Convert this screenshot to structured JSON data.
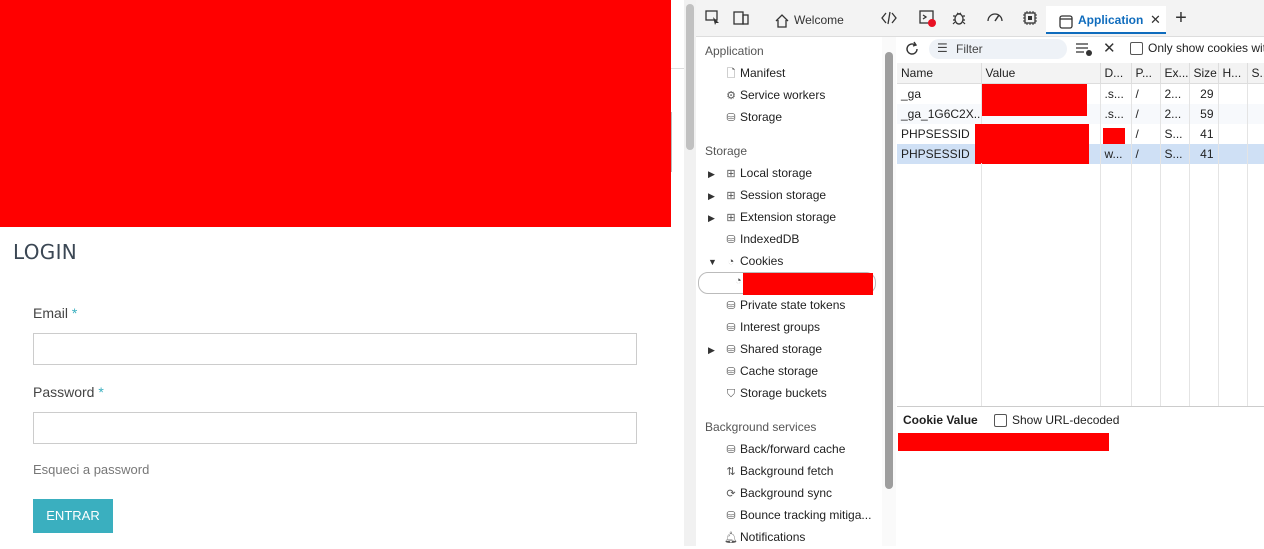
{
  "page": {
    "login_title": "LOGIN",
    "email_label": "Email",
    "password_label": "Password",
    "required_mark": "*",
    "forgot_link": "Esqueci a password",
    "submit_label": "ENTRAR"
  },
  "devtools": {
    "tabs": [
      {
        "label": "Welcome",
        "icon": "home-icon"
      },
      {
        "label": "Application",
        "icon": "window-icon"
      }
    ],
    "add_tab": "+",
    "close_tab": "✕",
    "filter_placeholder": "Filter",
    "only_show_label": "Only show cookies wit",
    "sidebar": {
      "sections": [
        {
          "title": "Application",
          "items": [
            {
              "label": "Manifest",
              "icon": "file-icon"
            },
            {
              "label": "Service workers",
              "icon": "gear-icon"
            },
            {
              "label": "Storage",
              "icon": "database-icon"
            }
          ]
        },
        {
          "title": "Storage",
          "items": [
            {
              "label": "Local storage",
              "icon": "grid-icon",
              "expandable": true
            },
            {
              "label": "Session storage",
              "icon": "grid-icon",
              "expandable": true
            },
            {
              "label": "Extension storage",
              "icon": "grid-icon",
              "expandable": true
            },
            {
              "label": "IndexedDB",
              "icon": "database-icon"
            },
            {
              "label": "Cookies",
              "icon": "cookie-icon",
              "expanded": true
            },
            {
              "label": "",
              "icon": "cookie-icon",
              "child": true,
              "redacted": true
            },
            {
              "label": "Private state tokens",
              "icon": "database-icon"
            },
            {
              "label": "Interest groups",
              "icon": "database-icon"
            },
            {
              "label": "Shared storage",
              "icon": "database-icon",
              "expandable": true
            },
            {
              "label": "Cache storage",
              "icon": "database-icon"
            },
            {
              "label": "Storage buckets",
              "icon": "bucket-icon"
            }
          ]
        },
        {
          "title": "Background services",
          "items": [
            {
              "label": "Back/forward cache",
              "icon": "database-icon"
            },
            {
              "label": "Background fetch",
              "icon": "arrows-updown-icon"
            },
            {
              "label": "Background sync",
              "icon": "sync-icon"
            },
            {
              "label": "Bounce tracking mitiga...",
              "icon": "database-icon"
            },
            {
              "label": "Notifications",
              "icon": "bell-icon"
            }
          ]
        }
      ]
    },
    "table": {
      "columns": [
        "Name",
        "Value",
        "D...",
        "P...",
        "Ex...",
        "Size",
        "H...",
        "S..."
      ],
      "rows": [
        {
          "name": "_ga",
          "value": "",
          "domain": ".s...",
          "path": "/",
          "expires": "2...",
          "size": "29",
          "httponly": "",
          "secure": ""
        },
        {
          "name": "_ga_1G6C2X...",
          "value": "",
          "domain": ".s...",
          "path": "/",
          "expires": "2...",
          "size": "59",
          "httponly": "",
          "secure": ""
        },
        {
          "name": "PHPSESSID",
          "value": "",
          "domain": "",
          "path": "/",
          "expires": "S...",
          "size": "41",
          "httponly": "",
          "secure": ""
        },
        {
          "name": "PHPSESSID",
          "value": "",
          "domain": "w...",
          "path": "/",
          "expires": "S...",
          "size": "41",
          "httponly": "",
          "secure": ""
        }
      ]
    },
    "cookie_value_label": "Cookie Value",
    "show_decoded_label": "Show URL-decoded"
  }
}
